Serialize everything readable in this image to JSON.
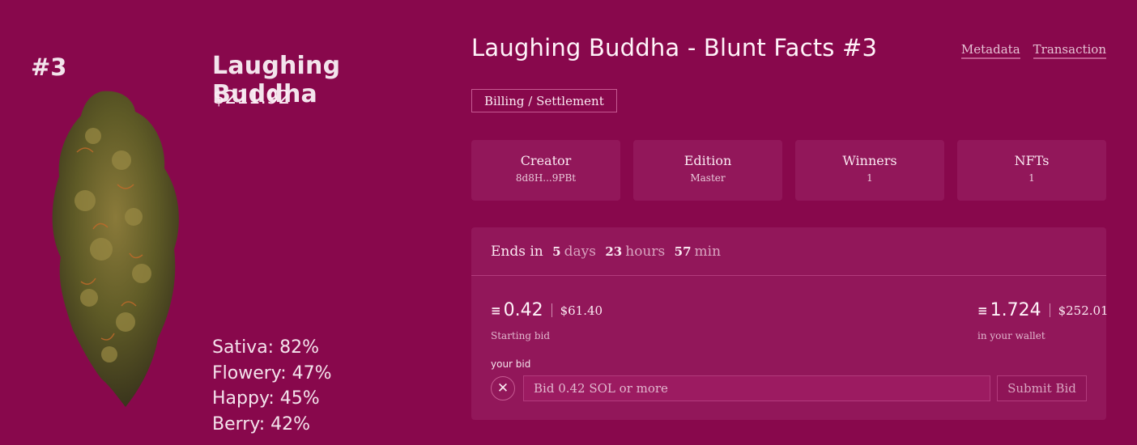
{
  "card": {
    "number": "#3",
    "name": "Laughing Buddha",
    "price": "$211.92",
    "stats": [
      {
        "label": "Sativa: 82%"
      },
      {
        "label": "Flowery: 47%"
      },
      {
        "label": "Happy: 45%"
      },
      {
        "label": "Berry: 42%"
      }
    ]
  },
  "header": {
    "title": "Laughing Buddha - Blunt Facts #3",
    "links": [
      "Metadata",
      "Transaction"
    ],
    "billing_label": "Billing / Settlement"
  },
  "info": [
    {
      "label": "Creator",
      "value": "8d8H...9PBt"
    },
    {
      "label": "Edition",
      "value": "Master"
    },
    {
      "label": "Winners",
      "value": "1"
    },
    {
      "label": "NFTs",
      "value": "1"
    }
  ],
  "auction": {
    "ends_label": "Ends in",
    "days": "5",
    "days_unit": "days",
    "hours": "23",
    "hours_unit": "hours",
    "mins": "57",
    "mins_unit": "min",
    "starting_bid_sol": "0.42",
    "starting_bid_usd": "$61.40",
    "starting_bid_label": "Starting bid",
    "wallet_sol": "1.724",
    "wallet_usd": "$252.01",
    "wallet_label": "in your wallet",
    "sol_mark": "≡",
    "your_bid_label": "your bid",
    "close_symbol": "✕",
    "bid_placeholder": "Bid 0.42 SOL or more",
    "submit_label": "Submit Bid"
  },
  "colors": {
    "background": "#88084c",
    "panel": "#92175a",
    "accent_border": "#c65a92"
  }
}
